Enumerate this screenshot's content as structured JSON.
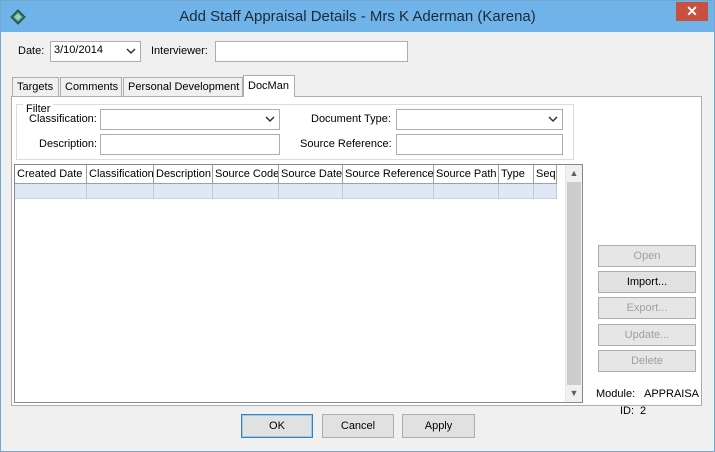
{
  "window": {
    "title": "Add Staff Appraisal Details - Mrs K Aderman (Karena)",
    "close_glyph": "✕",
    "icon": "app-diamond-icon"
  },
  "header": {
    "date_label": "Date:",
    "date_value": "3/10/2014",
    "interviewer_label": "Interviewer:",
    "interviewer_value": ""
  },
  "tabs": [
    {
      "label": "Targets"
    },
    {
      "label": "Comments"
    },
    {
      "label": "Personal Development"
    },
    {
      "label": "DocMan",
      "active": true
    }
  ],
  "filter": {
    "title": "Filter",
    "classification_label": "Classification:",
    "classification_value": "",
    "document_type_label": "Document Type:",
    "document_type_value": "",
    "description_label": "Description:",
    "description_value": "",
    "source_reference_label": "Source Reference:",
    "source_reference_value": ""
  },
  "grid": {
    "columns": [
      "Created Date",
      "Classification",
      "Description",
      "Source Code",
      "Source Date",
      "Source Reference",
      "Source Path",
      "Type",
      "Seq"
    ],
    "rows": [
      [
        "",
        "",
        "",
        "",
        "",
        "",
        "",
        "",
        ""
      ]
    ]
  },
  "side_buttons": {
    "open": "Open",
    "import": "Import...",
    "export": "Export...",
    "update": "Update...",
    "delete": "Delete"
  },
  "info": {
    "module_label": "Module:",
    "module_value": "APPRAISA",
    "id_label": "ID:",
    "id_value": "2"
  },
  "bottom_buttons": {
    "ok": "OK",
    "cancel": "Cancel",
    "apply": "Apply"
  },
  "colors": {
    "titlebar": "#6fb3e8",
    "close_button": "#c7503e",
    "selected_row": "#dfe8f6"
  }
}
